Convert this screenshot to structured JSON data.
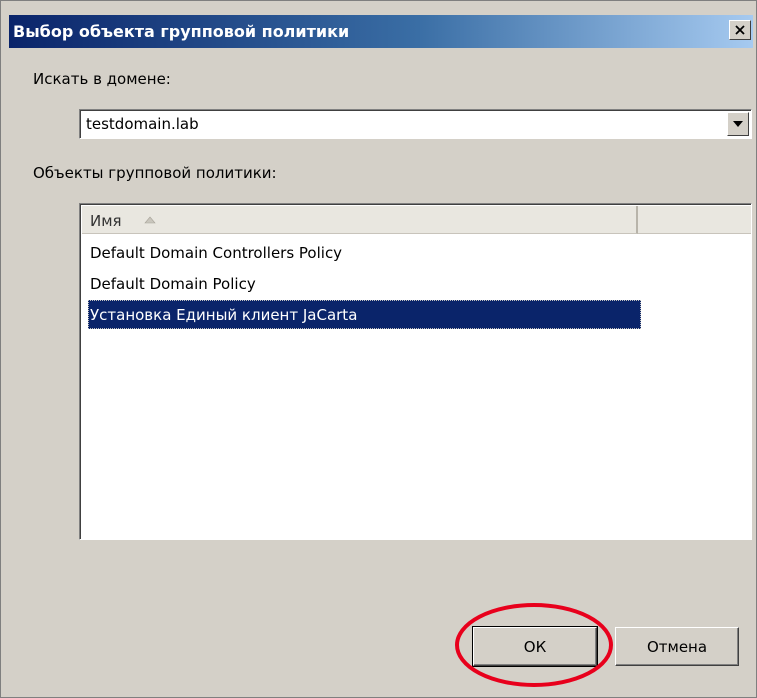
{
  "window": {
    "title": "Выбор объекта групповой политики"
  },
  "domain": {
    "label": "Искать в домене:",
    "value": "testdomain.lab"
  },
  "gpo": {
    "label": "Объекты групповой политики:",
    "column_name": "Имя",
    "rows": [
      {
        "name": "Default Domain Controllers Policy",
        "selected": false
      },
      {
        "name": "Default Domain Policy",
        "selected": false
      },
      {
        "name": "Установка Единый клиент JaCarta",
        "selected": true
      }
    ]
  },
  "buttons": {
    "ok": "ОК",
    "cancel": "Отмена"
  },
  "colors": {
    "selection": "#0a246a",
    "annotation": "#e8001c"
  },
  "icons": [
    "close-icon",
    "dropdown-arrow-icon",
    "sort-ascending-icon"
  ]
}
